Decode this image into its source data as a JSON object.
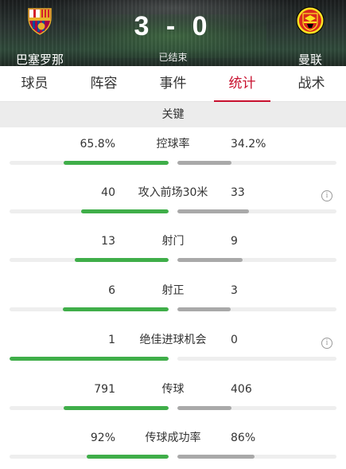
{
  "match": {
    "home_team": "巴塞罗那",
    "away_team": "曼联",
    "score": "3 - 0",
    "status": "已结束"
  },
  "tabs": [
    {
      "label": "球员",
      "active": false
    },
    {
      "label": "阵容",
      "active": false
    },
    {
      "label": "事件",
      "active": false
    },
    {
      "label": "统计",
      "active": true
    },
    {
      "label": "战术",
      "active": false
    }
  ],
  "section_title": "关键",
  "colors": {
    "accent": "#c8102e",
    "home_bar": "#3fae49",
    "away_bar": "#a9a9a9"
  },
  "stats": [
    {
      "label": "控球率",
      "home": "65.8%",
      "away": "34.2%",
      "home_frac": 0.658,
      "away_frac": 0.342,
      "info": false
    },
    {
      "label": "攻入前场30米",
      "home": "40",
      "away": "33",
      "home_frac": 0.548,
      "away_frac": 0.452,
      "info": true
    },
    {
      "label": "射门",
      "home": "13",
      "away": "9",
      "home_frac": 0.591,
      "away_frac": 0.409,
      "info": false
    },
    {
      "label": "射正",
      "home": "6",
      "away": "3",
      "home_frac": 0.667,
      "away_frac": 0.333,
      "info": false
    },
    {
      "label": "绝佳进球机会",
      "home": "1",
      "away": "0",
      "home_frac": 1.0,
      "away_frac": 0.0,
      "info": true
    },
    {
      "label": "传球",
      "home": "791",
      "away": "406",
      "home_frac": 0.661,
      "away_frac": 0.339,
      "info": false
    },
    {
      "label": "传球成功率",
      "home": "92%",
      "away": "86%",
      "home_frac": 0.517,
      "away_frac": 0.483,
      "info": false
    }
  ],
  "info_glyph": "i"
}
